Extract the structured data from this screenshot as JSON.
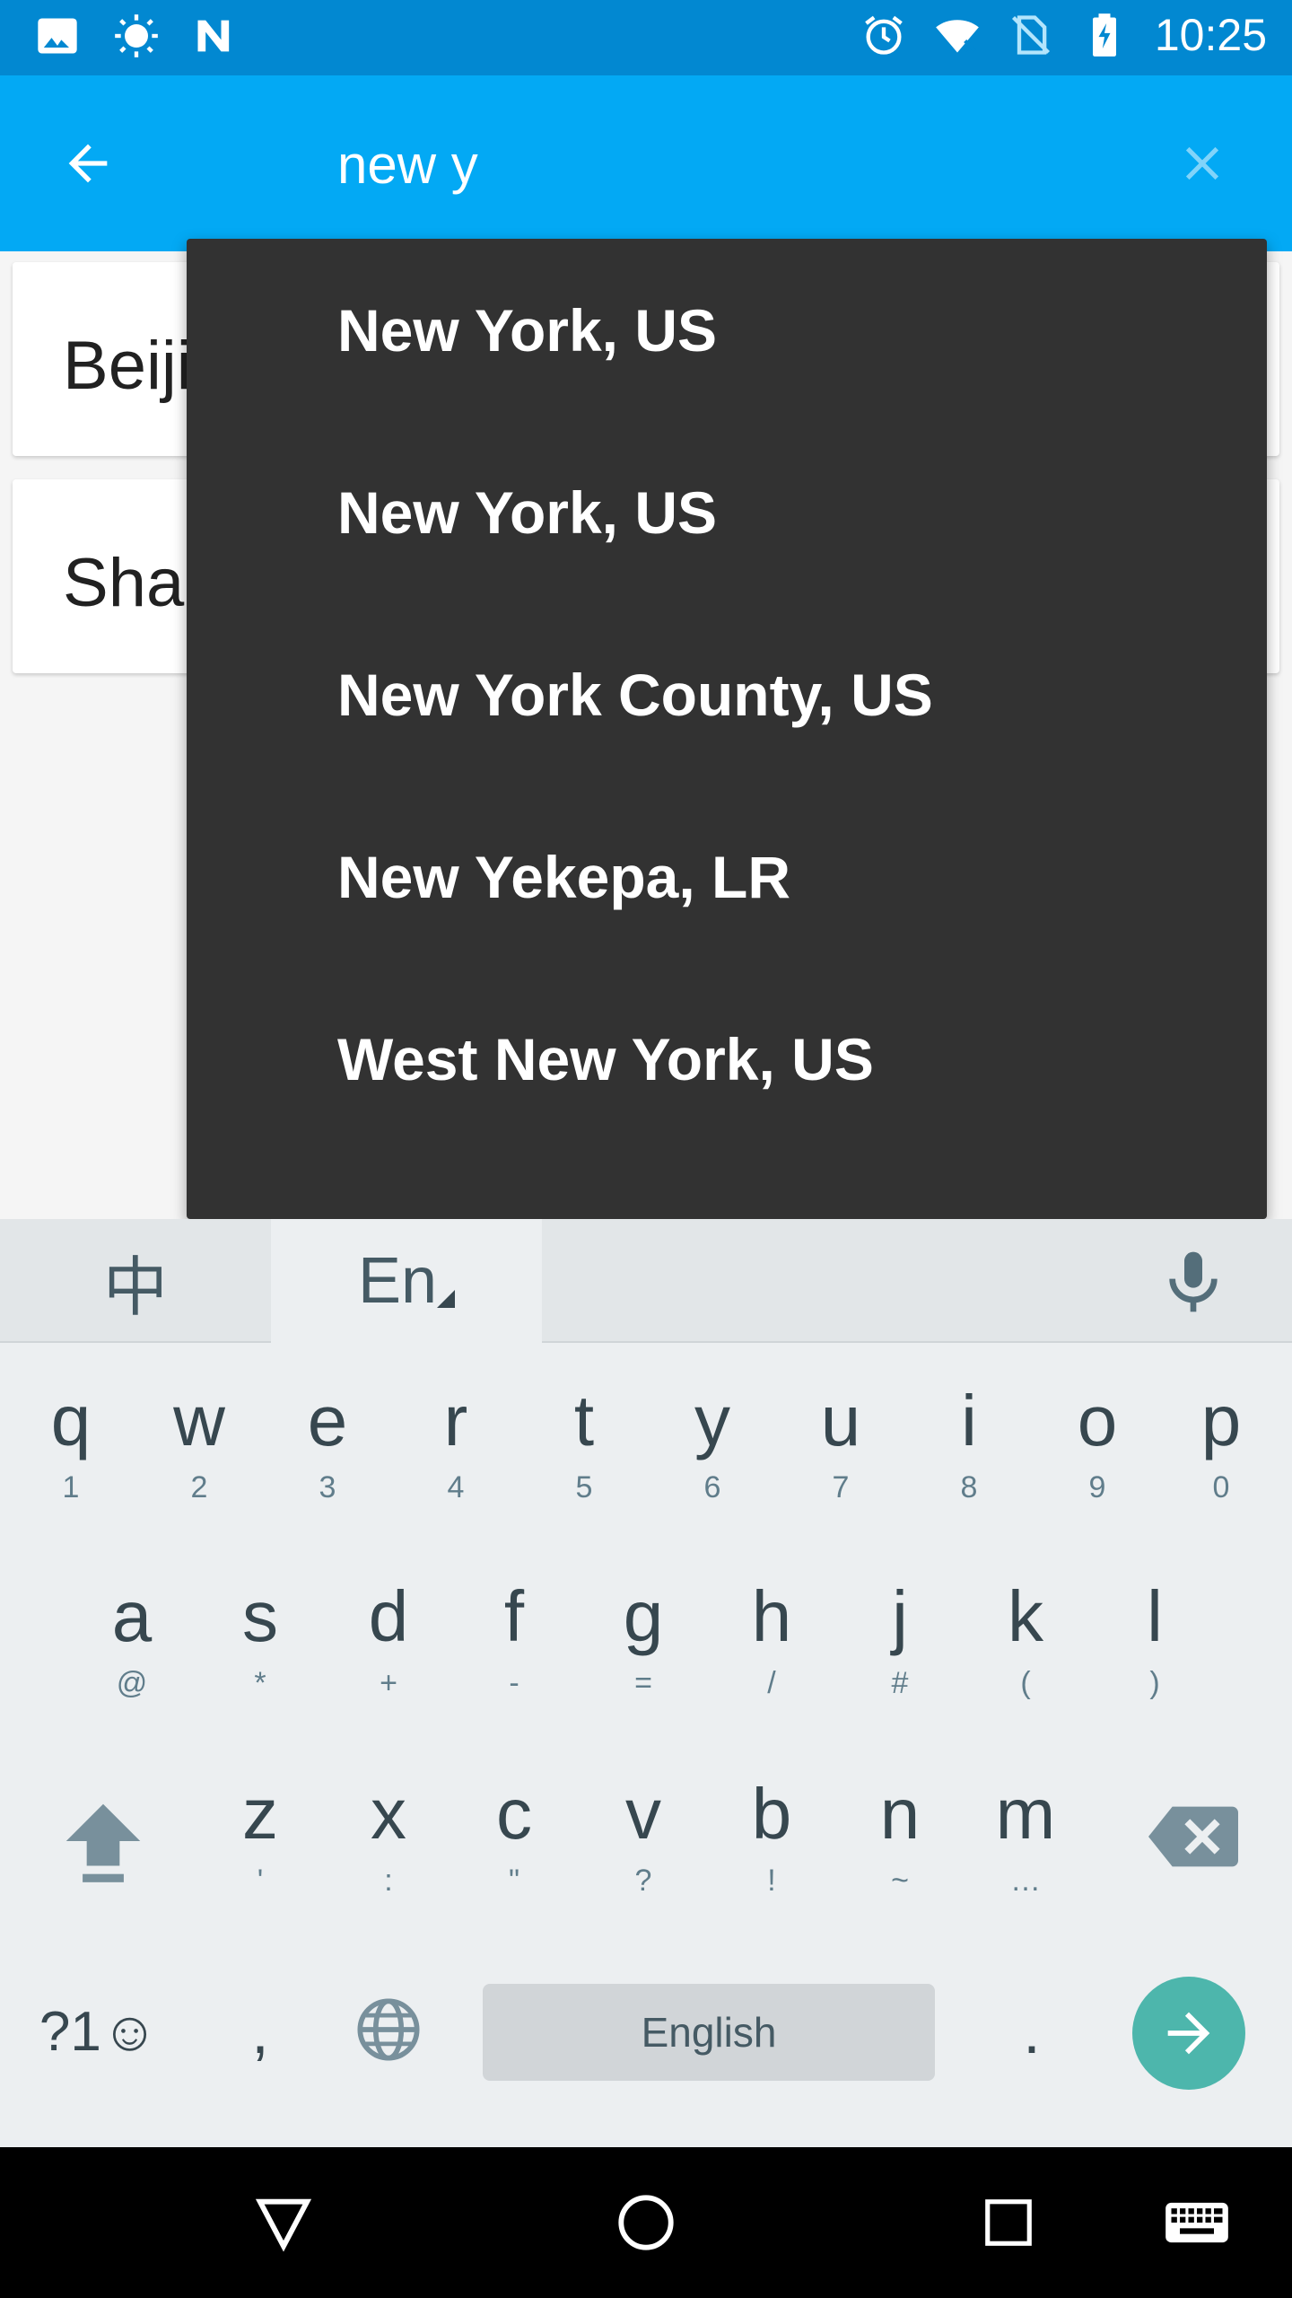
{
  "status_bar": {
    "time": "10:25",
    "left_icons": [
      "image-icon",
      "brightness-icon",
      "n-logo-icon"
    ],
    "right_icons": [
      "alarm-icon",
      "wifi-icon",
      "no-sim-icon",
      "battery-charging-icon"
    ]
  },
  "search": {
    "query": "new y"
  },
  "cities": [
    {
      "label": "Beiji"
    },
    {
      "label": "Shar"
    }
  ],
  "suggestions": [
    {
      "label": "New York, US"
    },
    {
      "label": "New York, US"
    },
    {
      "label": "New York County, US"
    },
    {
      "label": "New Yekepa, LR"
    },
    {
      "label": "West New York, US"
    }
  ],
  "keyboard": {
    "tab_chinese": "中",
    "tab_english": "En",
    "row1": [
      {
        "k": "q",
        "s": "1"
      },
      {
        "k": "w",
        "s": "2"
      },
      {
        "k": "e",
        "s": "3"
      },
      {
        "k": "r",
        "s": "4"
      },
      {
        "k": "t",
        "s": "5"
      },
      {
        "k": "y",
        "s": "6"
      },
      {
        "k": "u",
        "s": "7"
      },
      {
        "k": "i",
        "s": "8"
      },
      {
        "k": "o",
        "s": "9"
      },
      {
        "k": "p",
        "s": "0"
      }
    ],
    "row2": [
      {
        "k": "a",
        "s": "@"
      },
      {
        "k": "s",
        "s": "*"
      },
      {
        "k": "d",
        "s": "+"
      },
      {
        "k": "f",
        "s": "-"
      },
      {
        "k": "g",
        "s": "="
      },
      {
        "k": "h",
        "s": "/"
      },
      {
        "k": "j",
        "s": "#"
      },
      {
        "k": "k",
        "s": "("
      },
      {
        "k": "l",
        "s": ")"
      }
    ],
    "row3": [
      {
        "k": "z",
        "s": "'"
      },
      {
        "k": "x",
        "s": ":"
      },
      {
        "k": "c",
        "s": "\""
      },
      {
        "k": "v",
        "s": "?"
      },
      {
        "k": "b",
        "s": "!"
      },
      {
        "k": "n",
        "s": "~"
      },
      {
        "k": "m",
        "s": "…"
      }
    ],
    "symbols_label": "?1☺",
    "comma": ",",
    "space_label": "English",
    "period": ".",
    "accent_color": "#4db6ac"
  },
  "colors": {
    "status_bar": "#0288d1",
    "app_bar": "#03a9f4",
    "dropdown": "#323232"
  }
}
